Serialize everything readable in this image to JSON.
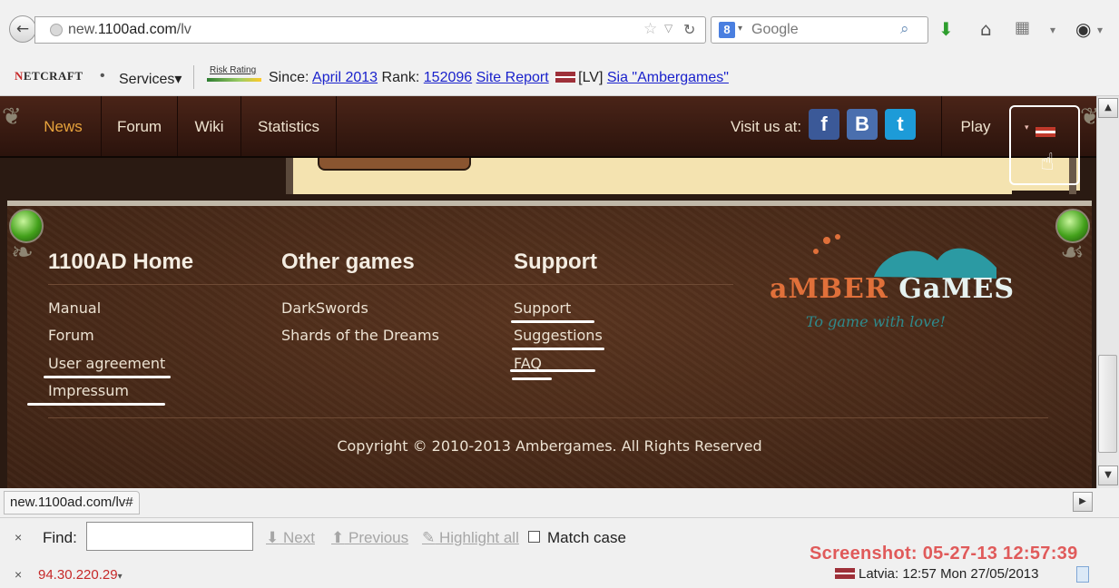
{
  "browser": {
    "url_host_prefix": "new.",
    "url_host_domain": "1100ad.com",
    "url_path": "/lv",
    "search_placeholder": "Google",
    "search_engine_letter": "8",
    "icons": [
      "back-icon",
      "globe-icon",
      "star-icon",
      "reload-icon",
      "search-icon",
      "download-icon",
      "home-icon",
      "bookmarks-icon",
      "addon-icon"
    ]
  },
  "netcraft": {
    "logo_first": "N",
    "logo_rest": "ETCRAFT",
    "dot": "•",
    "services": "Services▾",
    "risk_label": "Risk Rating",
    "since_label": "Since:",
    "since_value": "April 2013",
    "rank_label": "Rank:",
    "rank_value": "152096",
    "site_report": "Site Report",
    "country": "[LV]",
    "owner": "Sia \"Ambergames\""
  },
  "site": {
    "nav": [
      "News",
      "Forum",
      "Wiki",
      "Statistics"
    ],
    "visit_label": "Visit us at:",
    "social": [
      {
        "name": "facebook",
        "glyph": "f",
        "color": "#3b5998"
      },
      {
        "name": "draugiem",
        "glyph": "B",
        "color": "#4a6fae"
      },
      {
        "name": "twitter",
        "glyph": "t",
        "color": "#1d9bd8"
      }
    ],
    "play_label": "Play",
    "lang_caret": "▾"
  },
  "footer": {
    "col1": {
      "title": "1100AD Home",
      "links": [
        "Manual",
        "Forum",
        "User agreement",
        "Impressum"
      ]
    },
    "col2": {
      "title": "Other games",
      "links": [
        "DarkSwords",
        "Shards of the Dreams"
      ]
    },
    "col3": {
      "title": "Support",
      "links": [
        "Support",
        "Suggestions",
        "FAQ"
      ]
    },
    "logo_part1": "aMBER",
    "logo_part2": " GaMES",
    "logo_tagline": "To game with love!",
    "copyright": "Copyright © 2010-2013 Ambergames. All Rights Reserved",
    "colors": {
      "logo_orange": "#e0703a",
      "logo_teal": "#2b9aa3",
      "nav_active": "#e8a33c"
    }
  },
  "status": {
    "hover_url": "new.1100ad.com/lv#"
  },
  "findbar": {
    "close": "×",
    "label": "Find:",
    "value": "",
    "next": "Next",
    "previous": "Previous",
    "highlight": "Highlight all",
    "match_case": "Match case"
  },
  "bottom": {
    "close": "×",
    "ip": "94.30.220.29",
    "ip_caret": "▾",
    "country_time": "Latvia: 12:57 Mon 27/05/2013",
    "screenshot_stamp": "Screenshot: 05-27-13 12:57:39"
  }
}
